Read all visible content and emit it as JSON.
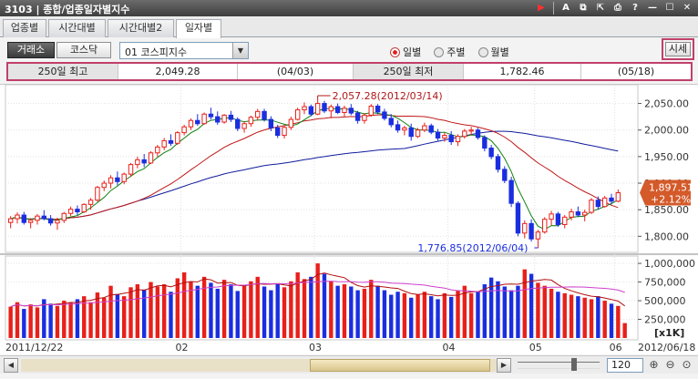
{
  "window": {
    "title": "3103 | 종합/업종일자별지수"
  },
  "tabs": [
    {
      "label": "업종별"
    },
    {
      "label": "시간대별"
    },
    {
      "label": "시간대별2"
    },
    {
      "label": "일자별",
      "active": true
    }
  ],
  "controls": {
    "market_kospi": "거래소",
    "market_kosdaq": "코스닥",
    "index_select": "01  코스피지수",
    "radio_daily": "일별",
    "radio_weekly": "주별",
    "radio_monthly": "월별",
    "selected_period": "일별",
    "sise_button": "시세"
  },
  "summary": {
    "high_label": "250일 최고",
    "high_value": "2,049.28",
    "high_date": "(04/03)",
    "low_label": "250일 최저",
    "low_value": "1,782.46",
    "low_date": "(05/18)"
  },
  "chart_data": {
    "type": "candlestick",
    "x_start_label": "2011/12/22",
    "x_end_label": "2012/06/18",
    "x_month_labels": [
      "02",
      "03",
      "04",
      "05",
      "06"
    ],
    "price_axis": {
      "ticks": [
        "2,050.00",
        "2,000.00",
        "1,950.00",
        "1,900.00",
        "1,850.00",
        "1,800.00"
      ],
      "range": [
        1780,
        2075
      ]
    },
    "volume_axis": {
      "ticks": [
        "1,000,000",
        "750,000",
        "500,000",
        "250,000"
      ],
      "unit": "[x1K]",
      "range": [
        0,
        1050000
      ]
    },
    "high_annotation": "2,057.28(2012/03/14)",
    "low_annotation": "1,776.85(2012/06/04)",
    "current_price": "1,897.51",
    "current_change": "+2.12%",
    "colors": {
      "up": "#e8201a",
      "down": "#1a2ee0",
      "ma5": "#cc2020",
      "ma20": "#108010",
      "ma60": "#c01818",
      "ma120": "#101c9c",
      "highlight": "#c0406a"
    },
    "candles": [
      [
        1826,
        1838,
        1815,
        1833
      ],
      [
        1833,
        1845,
        1824,
        1840
      ],
      [
        1840,
        1846,
        1822,
        1826
      ],
      [
        1826,
        1834,
        1815,
        1830
      ],
      [
        1830,
        1842,
        1822,
        1838
      ],
      [
        1838,
        1849,
        1830,
        1833
      ],
      [
        1833,
        1840,
        1820,
        1825
      ],
      [
        1825,
        1835,
        1812,
        1830
      ],
      [
        1830,
        1846,
        1825,
        1843
      ],
      [
        1843,
        1856,
        1838,
        1851
      ],
      [
        1851,
        1858,
        1840,
        1846
      ],
      [
        1846,
        1862,
        1844,
        1860
      ],
      [
        1860,
        1872,
        1850,
        1868
      ],
      [
        1868,
        1895,
        1865,
        1892
      ],
      [
        1892,
        1905,
        1885,
        1900
      ],
      [
        1900,
        1915,
        1890,
        1910
      ],
      [
        1910,
        1922,
        1896,
        1903
      ],
      [
        1903,
        1920,
        1898,
        1917
      ],
      [
        1917,
        1938,
        1912,
        1935
      ],
      [
        1935,
        1950,
        1928,
        1944
      ],
      [
        1944,
        1955,
        1930,
        1938
      ],
      [
        1938,
        1960,
        1936,
        1957
      ],
      [
        1957,
        1972,
        1950,
        1968
      ],
      [
        1968,
        1985,
        1962,
        1980
      ],
      [
        1980,
        1992,
        1970,
        1975
      ],
      [
        1975,
        1998,
        1972,
        1995
      ],
      [
        1995,
        2010,
        1990,
        2006
      ],
      [
        2006,
        2022,
        2000,
        2018
      ],
      [
        2018,
        2030,
        2008,
        2012
      ],
      [
        2012,
        2033,
        2010,
        2030
      ],
      [
        2030,
        2042,
        2020,
        2025
      ],
      [
        2025,
        2035,
        2010,
        2015
      ],
      [
        2015,
        2030,
        2012,
        2028
      ],
      [
        2028,
        2036,
        2015,
        2020
      ],
      [
        2020,
        2024,
        1998,
        2003
      ],
      [
        2003,
        2016,
        1995,
        2012
      ],
      [
        2012,
        2027,
        2006,
        2024
      ],
      [
        2024,
        2040,
        2018,
        2035
      ],
      [
        2035,
        2040,
        2016,
        2020
      ],
      [
        2020,
        2026,
        1998,
        2004
      ],
      [
        2004,
        2010,
        1985,
        1990
      ],
      [
        1990,
        2008,
        1984,
        2005
      ],
      [
        2005,
        2025,
        2000,
        2020
      ],
      [
        2020,
        2042,
        2018,
        2038
      ],
      [
        2038,
        2052,
        2030,
        2044
      ],
      [
        2044,
        2048,
        2026,
        2030
      ],
      [
        2030,
        2057,
        2028,
        2050
      ],
      [
        2050,
        2055,
        2032,
        2036
      ],
      [
        2036,
        2048,
        2022,
        2044
      ],
      [
        2044,
        2050,
        2030,
        2033
      ],
      [
        2033,
        2046,
        2025,
        2041
      ],
      [
        2041,
        2049,
        2028,
        2032
      ],
      [
        2032,
        2036,
        2012,
        2018
      ],
      [
        2018,
        2032,
        2012,
        2028
      ],
      [
        2028,
        2049,
        2025,
        2045
      ],
      [
        2045,
        2049,
        2030,
        2034
      ],
      [
        2034,
        2040,
        2018,
        2022
      ],
      [
        2022,
        2030,
        2005,
        2010
      ],
      [
        2010,
        2018,
        1995,
        2000
      ],
      [
        2000,
        2008,
        1990,
        2004
      ],
      [
        2004,
        2012,
        1980,
        1988
      ],
      [
        1988,
        2004,
        1985,
        2000
      ],
      [
        2000,
        2014,
        1996,
        2008
      ],
      [
        2008,
        2012,
        1992,
        1996
      ],
      [
        1996,
        2002,
        1980,
        1985
      ],
      [
        1985,
        1995,
        1978,
        1990
      ],
      [
        1990,
        1998,
        1972,
        1978
      ],
      [
        1978,
        1992,
        1970,
        1988
      ],
      [
        1988,
        2002,
        1984,
        1998
      ],
      [
        1998,
        2006,
        1990,
        2000
      ],
      [
        2000,
        2004,
        1982,
        1986
      ],
      [
        1986,
        1990,
        1960,
        1966
      ],
      [
        1966,
        1972,
        1945,
        1950
      ],
      [
        1950,
        1955,
        1920,
        1926
      ],
      [
        1926,
        1932,
        1900,
        1905
      ],
      [
        1905,
        1912,
        1855,
        1862
      ],
      [
        1862,
        1866,
        1800,
        1806
      ],
      [
        1806,
        1830,
        1796,
        1824
      ],
      [
        1824,
        1832,
        1790,
        1795
      ],
      [
        1795,
        1812,
        1778,
        1808
      ],
      [
        1808,
        1836,
        1805,
        1832
      ],
      [
        1832,
        1848,
        1820,
        1842
      ],
      [
        1842,
        1846,
        1818,
        1822
      ],
      [
        1822,
        1840,
        1815,
        1836
      ],
      [
        1836,
        1852,
        1830,
        1846
      ],
      [
        1846,
        1856,
        1836,
        1840
      ],
      [
        1840,
        1850,
        1828,
        1845
      ],
      [
        1845,
        1872,
        1842,
        1868
      ],
      [
        1868,
        1875,
        1850,
        1856
      ],
      [
        1856,
        1876,
        1854,
        1872
      ],
      [
        1872,
        1880,
        1860,
        1866
      ],
      [
        1866,
        1888,
        1864,
        1882
      ]
    ],
    "volumes": [
      420,
      480,
      390,
      450,
      410,
      520,
      460,
      430,
      500,
      470,
      520,
      560,
      480,
      610,
      540,
      700,
      590,
      560,
      680,
      720,
      650,
      750,
      690,
      720,
      620,
      800,
      880,
      760,
      700,
      820,
      740,
      660,
      780,
      720,
      630,
      700,
      760,
      820,
      690,
      640,
      720,
      680,
      760,
      880,
      790,
      820,
      1000,
      860,
      760,
      700,
      720,
      690,
      640,
      660,
      780,
      700,
      640,
      580,
      620,
      600,
      540,
      580,
      620,
      560,
      520,
      600,
      550,
      640,
      700,
      600,
      620,
      720,
      810,
      760,
      690,
      640,
      700,
      920,
      860,
      740,
      700,
      660,
      620,
      600,
      580,
      560,
      540,
      520,
      560,
      500,
      460,
      430,
      200
    ]
  }
}
